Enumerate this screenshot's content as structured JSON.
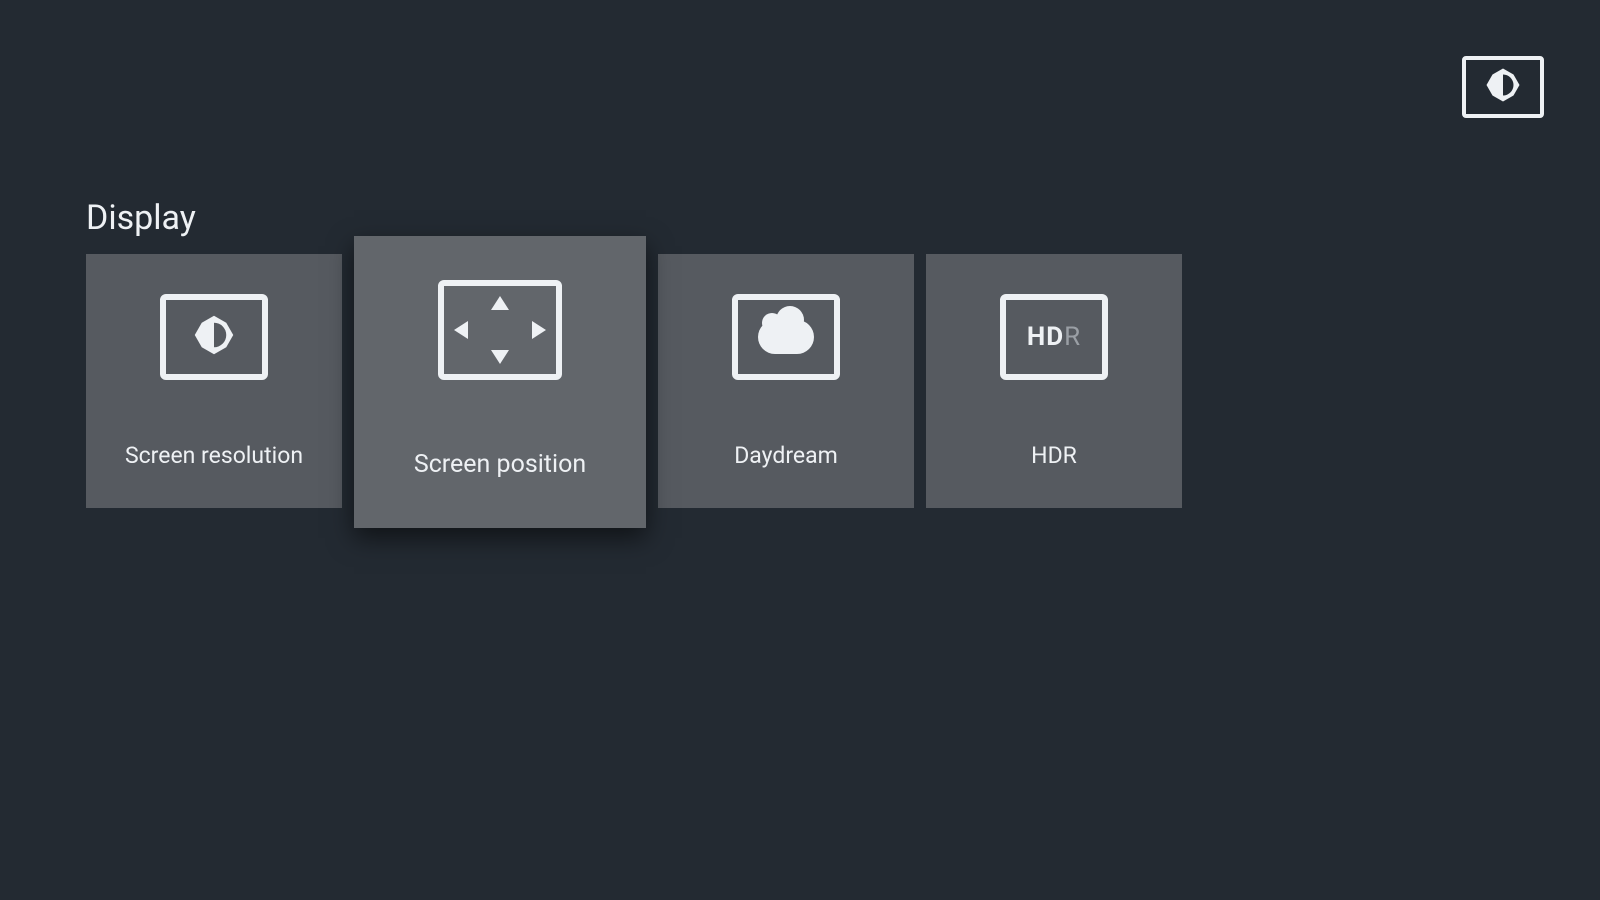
{
  "section": {
    "title": "Display"
  },
  "header_icon": "brightness-icon",
  "tiles": [
    {
      "label": "Screen resolution",
      "icon": "brightness-icon",
      "focused": false
    },
    {
      "label": "Screen position",
      "icon": "position-icon",
      "focused": true
    },
    {
      "label": "Daydream",
      "icon": "cloud-icon",
      "focused": false
    },
    {
      "label": "HDR",
      "icon": "hdr-icon",
      "focused": false
    }
  ],
  "hdr_label": {
    "bold": "HD",
    "faded": "R"
  }
}
